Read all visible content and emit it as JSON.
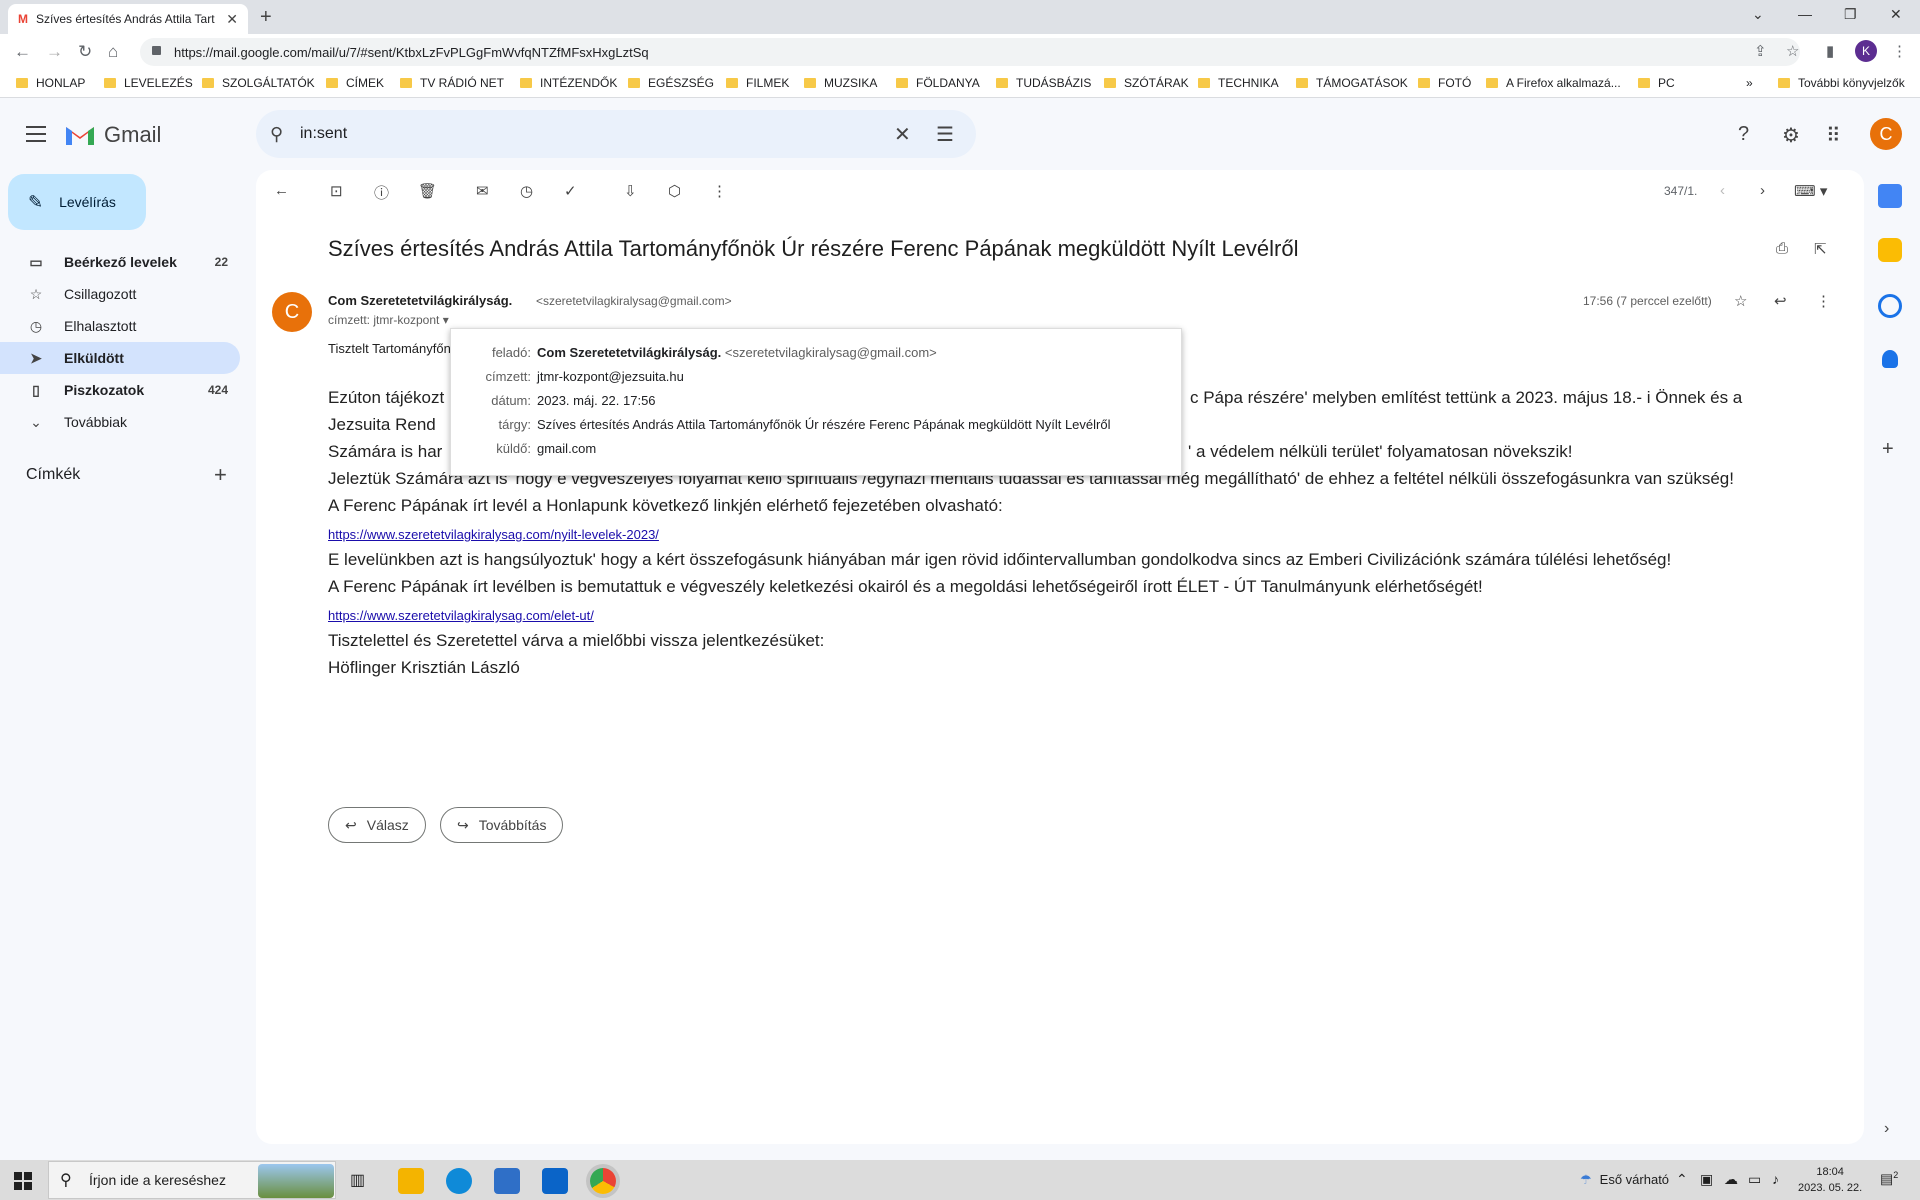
{
  "browser": {
    "tab_title": "Szíves értesítés András Attila Tart",
    "url": "https://mail.google.com/mail/u/7/#sent/KtbxLzFvPLGgFmWvfqNTZfMFsxHxgLztSq",
    "profile_initial": "K",
    "bookmarks": [
      "HONLAP",
      "LEVELEZÉS",
      "SZOLGÁLTATÓK",
      "CÍMEK",
      "TV RÁDIÓ NET",
      "INTÉZENDŐK",
      "EGÉSZSÉG",
      "FILMEK",
      "MUZSIKA",
      "FÖLDANYA",
      "TUDÁSBÁZIS",
      "SZÓTÁRAK",
      "TECHNIKA",
      "TÁMOGATÁSOK",
      "FOTÓ",
      "A Firefox alkalmazá...",
      "PC"
    ],
    "bookmarks_more": "»",
    "other_bookmarks": "További könyvjelzők"
  },
  "gmail": {
    "logo_text": "Gmail",
    "search_value": "in:sent",
    "account_initial": "C",
    "compose_label": "Levélírás",
    "nav": [
      {
        "label": "Beérkező levelek",
        "count": "22"
      },
      {
        "label": "Csillagozott",
        "count": ""
      },
      {
        "label": "Elhalasztott",
        "count": ""
      },
      {
        "label": "Elküldött",
        "count": ""
      },
      {
        "label": "Piszkozatok",
        "count": "424"
      },
      {
        "label": "Továbbiak",
        "count": ""
      }
    ],
    "labels_title": "Címkék",
    "pager": "347/1."
  },
  "email": {
    "subject": "Szíves értesítés András Attila Tartományfőnök Úr részére Ferenc Pápának megküldött Nyílt Levélről",
    "sender_initial": "C",
    "sender_name": "Com Szeretetetvilágkirályság.",
    "sender_email": "<szeretetvilagkiralysag@gmail.com>",
    "recipient": "címzett: jtmr-kozpont",
    "timestamp": "17:56 (7 perccel ezelőtt)",
    "greeting": "Tisztelt Tartományfőn",
    "body_line1_left": "Ezúton tájékozt",
    "body_line1_right": "c Pápa részére' melyben említést tettünk a 2023. május 18.- i Önnek és a",
    "body_line2_left": "Jezsuita Rend",
    "body_line3_left": "Számára is har",
    "body_line3_right": "' a védelem nélküli terület' folyamatosan növekszik!",
    "body_line4": "Jeleztük Számára azt is' hogy e végveszélyes folyamat kellő spirituális /egyházi mentális tudással és tanítással még megállítható' de ehhez a feltétel nélküli összefogásunkra van szükség!",
    "body_line5": "A Ferenc Pápának írt levél a Honlapunk következő linkjén elérhető fejezetében olvasható:",
    "link1": "https://www.szeretetvilagkiralysag.com/nyilt-levelek-2023/",
    "body_line6": "E levelünkben azt is hangsúlyoztuk' hogy a kért összefogásunk hiányában már igen rövid időintervallumban gondolkodva sincs az Emberi Civilizációnk számára túlélési lehetőség!",
    "body_line7": "A Ferenc Pápának írt levélben is bemutattuk e végveszély keletkezési okairól és a megoldási lehetőségeiről írott ÉLET - ÚT Tanulmányunk elérhetőségét!",
    "link2": "https://www.szeretetvilagkiralysag.com/elet-ut/",
    "body_line8": "Tisztelettel és Szeretettel várva a mielőbbi vissza jelentkezésüket:",
    "signature": "Höflinger Krisztián László",
    "reply_label": "Válasz",
    "forward_label": "Továbbítás"
  },
  "details_popup": {
    "from_label": "feladó:",
    "from_name": "Com Szeretetetvilágkirályság.",
    "from_email": "<szeretetvilagkiralysag@gmail.com>",
    "to_label": "címzett:",
    "to_value": "jtmr-kozpont@jezsuita.hu",
    "date_label": "dátum:",
    "date_value": "2023. máj. 22. 17:56",
    "subject_label": "tárgy:",
    "subject_value": "Szíves értesítés András Attila Tartományfőnök Úr részére Ferenc Pápának megküldött Nyílt Levélről",
    "mailedby_label": "küldő:",
    "mailedby_value": "gmail.com"
  },
  "taskbar": {
    "search_placeholder": "Írjon ide a kereséshez",
    "weather": "Eső várható",
    "time": "18:04",
    "date": "2023. 05. 22.",
    "notif_count": "2"
  },
  "colors": {
    "gmail_red": "#ea4335",
    "compose_bg": "#c2e7ff",
    "active_nav": "#d3e3fd",
    "avatar_orange": "#e8710a"
  }
}
